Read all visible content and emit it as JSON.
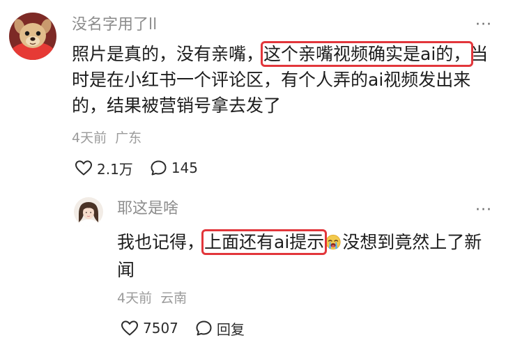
{
  "comment": {
    "username": "没名字用了ll",
    "more_label": "···",
    "text": {
      "line1_pre": "照片是真的，没有亲嘴，",
      "line1_highlight": "这个亲嘴视频确实是ai的，",
      "line1_post": "当",
      "line2": "时是在小红书一个评论区，有个人弄的ai视频发出来",
      "line3": "的，结果被营销号拿去发了"
    },
    "time": "4天前",
    "location": "广东",
    "like_count": "2.1万",
    "reply_count": "145",
    "avatar_icon": "dog-avatar",
    "highlight_color": "#e2363b"
  },
  "reply": {
    "username": "耶这是啥",
    "more_label": "···",
    "text": {
      "line1_pre": "我也记得，",
      "line1_highlight": "上面还有ai提示",
      "line1_post": "没想到竟然上了新",
      "line2": "闻"
    },
    "emoji_icon": "crying-face-emoji",
    "time": "4天前",
    "location": "云南",
    "like_count": "7507",
    "reply_label": "回复",
    "avatar_icon": "girl-avatar"
  }
}
